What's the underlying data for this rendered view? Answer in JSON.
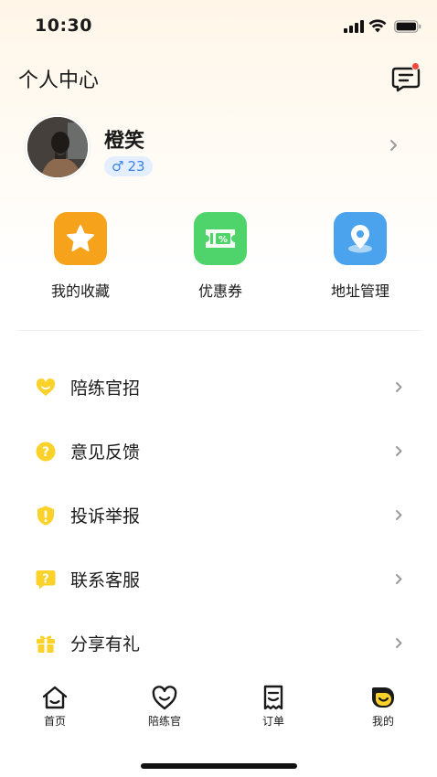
{
  "status_bar": {
    "time": "10:30"
  },
  "header": {
    "title": "个人中心"
  },
  "profile": {
    "name": "橙笑",
    "gender_symbol": "♂",
    "age": "23"
  },
  "shortcuts": [
    {
      "label": "我的收藏",
      "icon": "star-icon",
      "color": "#f7a21b"
    },
    {
      "label": "优惠券",
      "icon": "coupon-icon",
      "color": "#4fd46b"
    },
    {
      "label": "地址管理",
      "icon": "location-pin-icon",
      "color": "#4aa3ec"
    }
  ],
  "menu": [
    {
      "label": "陪练官招",
      "icon": "heart-icon"
    },
    {
      "label": "意见反馈",
      "icon": "question-icon"
    },
    {
      "label": "投诉举报",
      "icon": "warning-shield-icon"
    },
    {
      "label": "联系客服",
      "icon": "question-chat-icon"
    },
    {
      "label": "分享有礼",
      "icon": "gift-icon"
    }
  ],
  "tab_bar": [
    {
      "label": "首页",
      "icon": "home-icon",
      "active": false
    },
    {
      "label": "陪练官",
      "icon": "heart-smile-icon",
      "active": false
    },
    {
      "label": "订单",
      "icon": "receipt-icon",
      "active": false
    },
    {
      "label": "我的",
      "icon": "profile-smile-icon",
      "active": true
    }
  ],
  "colors": {
    "accent_yellow": "#fbd22a",
    "badge_blue": "#3b82e6",
    "notification_red": "#f0473d"
  }
}
